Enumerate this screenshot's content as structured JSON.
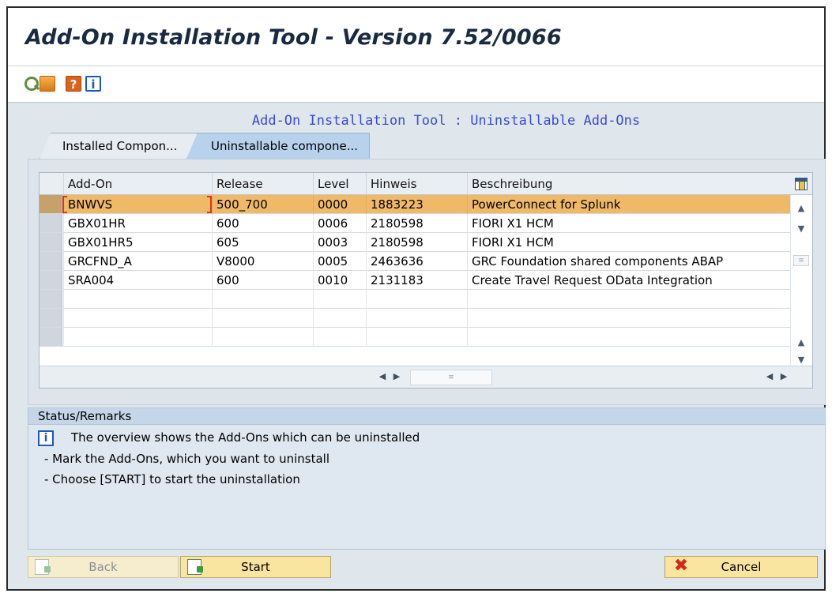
{
  "window": {
    "title": "Add-On Installation Tool - Version 7.52/0066"
  },
  "toolbar": {
    "icons": [
      "find-icon",
      "find-next-icon",
      "help-icon",
      "info-icon"
    ],
    "help_glyph": "?",
    "info_glyph": "i"
  },
  "heading": "Add-On Installation Tool : Uninstallable Add-Ons",
  "tabs": [
    {
      "label": "Installed Compon...",
      "active": false
    },
    {
      "label": "Uninstallable compone...",
      "active": true
    }
  ],
  "table": {
    "columns": [
      "Add-On",
      "Release",
      "Level",
      "Hinweis",
      "Beschreibung"
    ],
    "rows": [
      {
        "addon": "BNWVS",
        "release": "500_700",
        "level": "0000",
        "hinweis": "1883223",
        "beschreibung": "PowerConnect for Splunk",
        "selected": true
      },
      {
        "addon": "GBX01HR",
        "release": "600",
        "level": "0006",
        "hinweis": "2180598",
        "beschreibung": "FIORI X1 HCM",
        "selected": false
      },
      {
        "addon": "GBX01HR5",
        "release": "605",
        "level": "0003",
        "hinweis": "2180598",
        "beschreibung": "FIORI X1 HCM",
        "selected": false
      },
      {
        "addon": "GRCFND_A",
        "release": "V8000",
        "level": "0005",
        "hinweis": "2463636",
        "beschreibung": "GRC Foundation shared components ABAP",
        "selected": false
      },
      {
        "addon": "SRA004",
        "release": "600",
        "level": "0010",
        "hinweis": "2131183",
        "beschreibung": "Create Travel Request OData Integration",
        "selected": false
      }
    ],
    "empty_rows": 3
  },
  "status": {
    "header": "Status/Remarks",
    "info_glyph": "i",
    "lines": [
      "The overview shows the Add-Ons which can be uninstalled",
      "- Mark the Add-Ons, which you want to uninstall",
      "- Choose [START] to start the uninstallation"
    ]
  },
  "buttons": {
    "back": "Back",
    "start": "Start",
    "cancel": "Cancel"
  },
  "colors": {
    "selected_row": "#f0b968",
    "heading": "#3b4bd1",
    "button": "#fae5a0"
  }
}
